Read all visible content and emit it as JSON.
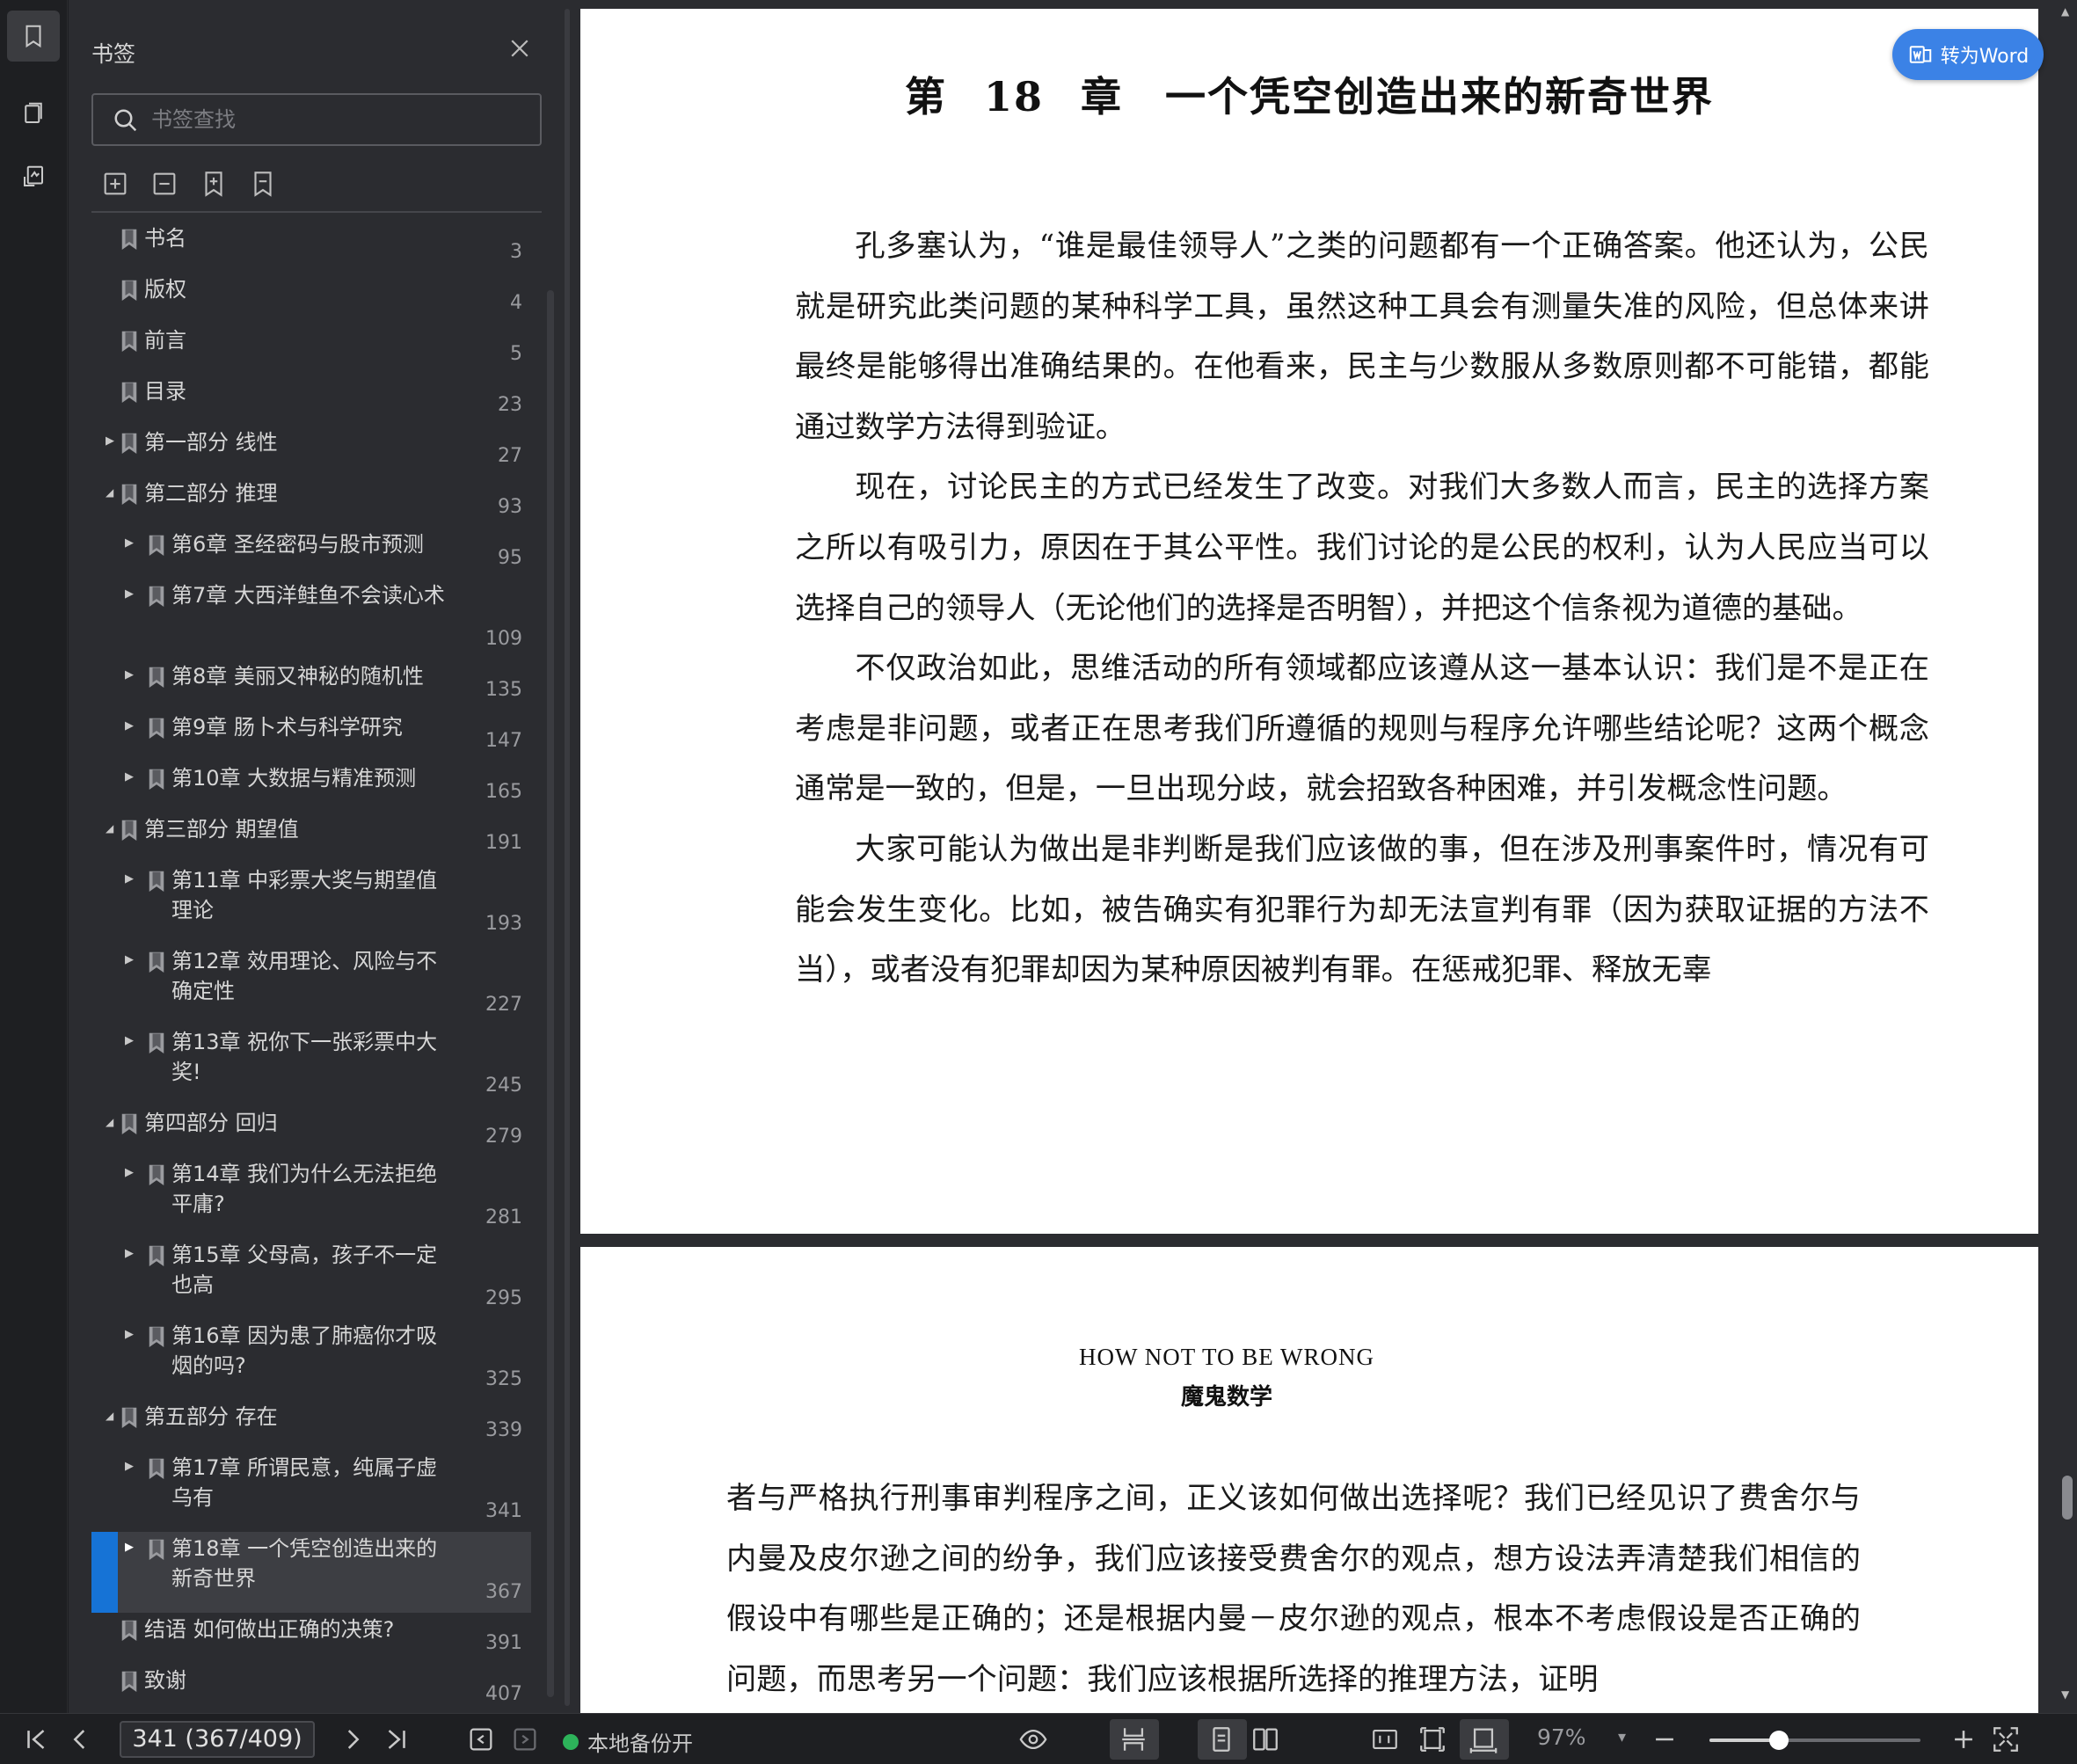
{
  "sidebar": {
    "title": "书签",
    "search_placeholder": "书签查找",
    "items": [
      {
        "label": "书名",
        "page": "3",
        "level": 0,
        "expand": "none"
      },
      {
        "label": "版权",
        "page": "4",
        "level": 0,
        "expand": "none"
      },
      {
        "label": "前言",
        "page": "5",
        "level": 0,
        "expand": "none"
      },
      {
        "label": "目录",
        "page": "23",
        "level": 0,
        "expand": "none"
      },
      {
        "label": "第一部分 线性",
        "page": "27",
        "level": 0,
        "expand": "collapsed"
      },
      {
        "label": "第二部分 推理",
        "page": "93",
        "level": 0,
        "expand": "expanded"
      },
      {
        "label": "第6章 圣经密码与股市预测",
        "page": "95",
        "level": 1,
        "expand": "collapsed"
      },
      {
        "label": "第7章 大西洋鲑鱼不会读心术",
        "page": "109",
        "level": 1,
        "expand": "collapsed"
      },
      {
        "label": "第8章 美丽又神秘的随机性",
        "page": "135",
        "level": 1,
        "expand": "collapsed"
      },
      {
        "label": "第9章 肠卜术与科学研究",
        "page": "147",
        "level": 1,
        "expand": "collapsed"
      },
      {
        "label": "第10章 大数据与精准预测",
        "page": "165",
        "level": 1,
        "expand": "collapsed"
      },
      {
        "label": "第三部分 期望值",
        "page": "191",
        "level": 0,
        "expand": "expanded"
      },
      {
        "label": "第11章 中彩票大奖与期望值理论",
        "page": "193",
        "level": 1,
        "expand": "collapsed"
      },
      {
        "label": "第12章 效用理论、风险与不确定性",
        "page": "227",
        "level": 1,
        "expand": "collapsed"
      },
      {
        "label": "第13章 祝你下一张彩票中大奖!",
        "page": "245",
        "level": 1,
        "expand": "collapsed"
      },
      {
        "label": "第四部分 回归",
        "page": "279",
        "level": 0,
        "expand": "expanded"
      },
      {
        "label": "第14章 我们为什么无法拒绝平庸?",
        "page": "281",
        "level": 1,
        "expand": "collapsed"
      },
      {
        "label": "第15章 父母高，孩子不一定也高",
        "page": "295",
        "level": 1,
        "expand": "collapsed"
      },
      {
        "label": "第16章 因为患了肺癌你才吸烟的吗?",
        "page": "325",
        "level": 1,
        "expand": "collapsed"
      },
      {
        "label": "第五部分 存在",
        "page": "339",
        "level": 0,
        "expand": "expanded"
      },
      {
        "label": "第17章 所谓民意，纯属子虚乌有",
        "page": "341",
        "level": 1,
        "expand": "collapsed"
      },
      {
        "label": "第18章 一个凭空创造出来的新奇世界",
        "page": "367",
        "level": 1,
        "expand": "collapsed",
        "selected": true
      },
      {
        "label": "结语 如何做出正确的决策?",
        "page": "391",
        "level": 0,
        "expand": "none"
      },
      {
        "label": "致谢",
        "page": "407",
        "level": 0,
        "expand": "none"
      }
    ]
  },
  "document": {
    "chapter_title": "第 18 章　一个凭空创造出来的新奇世界",
    "page1_paragraphs": [
      "孔多塞认为，“谁是最佳领导人”之类的问题都有一个正确答案。他还认为，公民就是研究此类问题的某种科学工具，虽然这种工具会有测量失准的风险，但总体来讲最终是能够得出准确结果的。在他看来，民主与少数服从多数原则都不可能错，都能通过数学方法得到验证。",
      "现在，讨论民主的方式已经发生了改变。对我们大多数人而言，民主的选择方案之所以有吸引力，原因在于其公平性。我们讨论的是公民的权利，认为人民应当可以选择自己的领导人（无论他们的选择是否明智），并把这个信条视为道德的基础。",
      "不仅政治如此，思维活动的所有领域都应该遵从这一基本认识：我们是不是正在考虑是非问题，或者正在思考我们所遵循的规则与程序允许哪些结论呢？这两个概念通常是一致的，但是，一旦出现分歧，就会招致各种困难，并引发概念性问题。",
      "大家可能认为做出是非判断是我们应该做的事，但在涉及刑事案件时，情况有可能会发生变化。比如，被告确实有犯罪行为却无法宣判有罪（因为获取证据的方法不当），或者没有犯罪却因为某种原因被判有罪。在惩戒犯罪、释放无辜"
    ],
    "page2_header_en": "HOW NOT TO BE WRONG",
    "page2_header_zh": "魔鬼数学",
    "page2_text": "者与严格执行刑事审判程序之间，正义该如何做出选择呢？我们已经见识了费舍尔与内曼及皮尔逊之间的纷争，我们应该接受费舍尔的观点，想方设法弄清楚我们相信的假设中有哪些是正确的；还是根据内曼－皮尔逊的观点，根本不考虑假设是否正确的问题，而思考另一个问题：我们应该根据所选择的推理方法，证明",
    "to_word_label": "转为Word"
  },
  "statusbar": {
    "page_indicator": "341 (367/409)",
    "backup_label": "本地备份开",
    "zoom": "97%",
    "zoom_fraction": 0.33
  },
  "colors": {
    "accent": "#1673d6",
    "to_word_bg": "#3b82e6",
    "backup_dot": "#2db35a"
  }
}
